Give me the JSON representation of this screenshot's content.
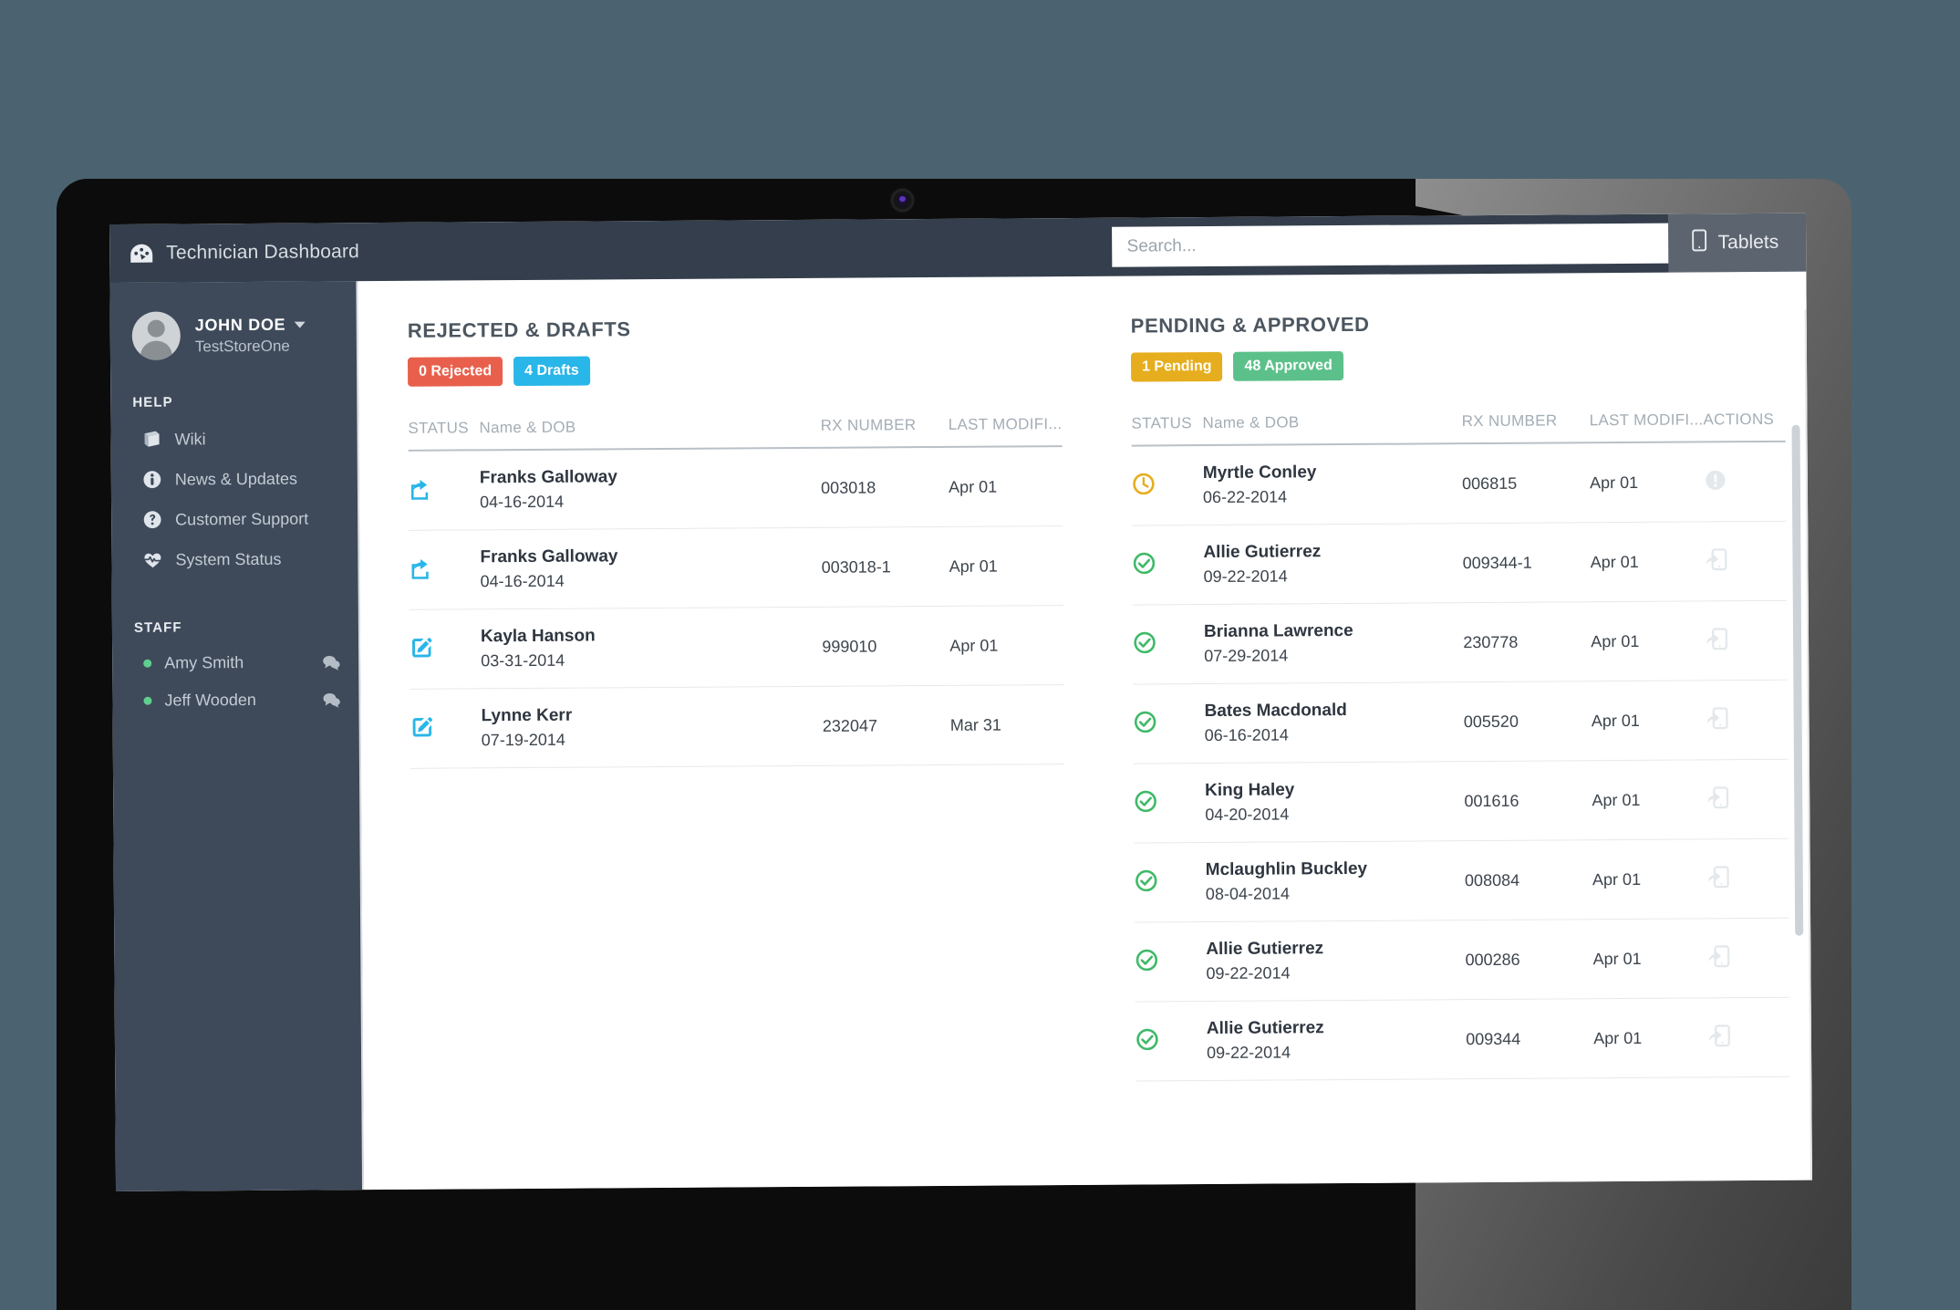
{
  "colors": {
    "page_background": "#4b6370",
    "topbar": "#343e4c",
    "sidebar": "#3e4a5a",
    "accent_blue": "#29b6e8",
    "rejected": "#e8604c",
    "drafts": "#29b6e8",
    "pending": "#e6ad1e",
    "approved": "#5cc08a",
    "online_dot": "#5fcf8d"
  },
  "topbar": {
    "brand_icon": "dashboard-gauge-icon",
    "title": "Technician Dashboard",
    "search_placeholder": "Search...",
    "search_value": "",
    "tablets_label": "Tablets",
    "tablets_icon": "tablet-icon"
  },
  "sidebar": {
    "user": {
      "name": "JOHN DOE",
      "store": "TestStoreOne",
      "avatar_icon": "user-avatar-icon",
      "caret_icon": "chevron-down-icon"
    },
    "help_heading": "HELP",
    "help_items": [
      {
        "label": "Wiki",
        "icon": "book-icon"
      },
      {
        "label": "News & Updates",
        "icon": "info-circle-icon"
      },
      {
        "label": "Customer Support",
        "icon": "question-circle-icon"
      },
      {
        "label": "System Status",
        "icon": "heartbeat-icon"
      }
    ],
    "staff_heading": "STAFF",
    "staff_items": [
      {
        "label": "Amy Smith",
        "status": "online",
        "chat_icon": "chat-bubbles-icon"
      },
      {
        "label": "Jeff Wooden",
        "status": "online",
        "chat_icon": "chat-bubbles-icon"
      }
    ]
  },
  "panels": {
    "left": {
      "title": "REJECTED & DRAFTS",
      "pills": [
        {
          "label": "0 Rejected",
          "kind": "rejected"
        },
        {
          "label": "4 Drafts",
          "kind": "drafts"
        }
      ],
      "columns": [
        "STATUS",
        "Name & DOB",
        "RX NUMBER",
        "LAST MODIFI..."
      ],
      "rows": [
        {
          "status_icon": "share-square-icon",
          "name": "Franks Galloway",
          "dob": "04-16-2014",
          "rx": "003018",
          "modified": "Apr 01"
        },
        {
          "status_icon": "share-square-icon",
          "name": "Franks Galloway",
          "dob": "04-16-2014",
          "rx": "003018-1",
          "modified": "Apr 01"
        },
        {
          "status_icon": "edit-square-icon",
          "name": "Kayla Hanson",
          "dob": "03-31-2014",
          "rx": "999010",
          "modified": "Apr 01"
        },
        {
          "status_icon": "edit-square-icon",
          "name": "Lynne Kerr",
          "dob": "07-19-2014",
          "rx": "232047",
          "modified": "Mar 31"
        }
      ]
    },
    "right": {
      "title": "PENDING & APPROVED",
      "pills": [
        {
          "label": "1 Pending",
          "kind": "pending"
        },
        {
          "label": "48 Approved",
          "kind": "approved"
        }
      ],
      "columns": [
        "STATUS",
        "Name & DOB",
        "RX NUMBER",
        "LAST MODIFI...",
        "ACTIONS"
      ],
      "rows": [
        {
          "status_icon": "clock-circle-icon",
          "name": "Myrtle Conley",
          "dob": "06-22-2014",
          "rx": "006815",
          "modified": "Apr 01",
          "action_icon": "exclamation-circle-icon"
        },
        {
          "status_icon": "check-circle-icon",
          "name": "Allie Gutierrez",
          "dob": "09-22-2014",
          "rx": "009344-1",
          "modified": "Apr 01",
          "action_icon": "send-to-tablet-icon"
        },
        {
          "status_icon": "check-circle-icon",
          "name": "Brianna Lawrence",
          "dob": "07-29-2014",
          "rx": "230778",
          "modified": "Apr 01",
          "action_icon": "send-to-tablet-icon"
        },
        {
          "status_icon": "check-circle-icon",
          "name": "Bates Macdonald",
          "dob": "06-16-2014",
          "rx": "005520",
          "modified": "Apr 01",
          "action_icon": "send-to-tablet-icon"
        },
        {
          "status_icon": "check-circle-icon",
          "name": "King Haley",
          "dob": "04-20-2014",
          "rx": "001616",
          "modified": "Apr 01",
          "action_icon": "send-to-tablet-icon"
        },
        {
          "status_icon": "check-circle-icon",
          "name": "Mclaughlin Buckley",
          "dob": "08-04-2014",
          "rx": "008084",
          "modified": "Apr 01",
          "action_icon": "send-to-tablet-icon"
        },
        {
          "status_icon": "check-circle-icon",
          "name": "Allie Gutierrez",
          "dob": "09-22-2014",
          "rx": "000286",
          "modified": "Apr 01",
          "action_icon": "send-to-tablet-icon"
        },
        {
          "status_icon": "check-circle-icon",
          "name": "Allie Gutierrez",
          "dob": "09-22-2014",
          "rx": "009344",
          "modified": "Apr 01",
          "action_icon": "send-to-tablet-icon"
        }
      ]
    }
  }
}
